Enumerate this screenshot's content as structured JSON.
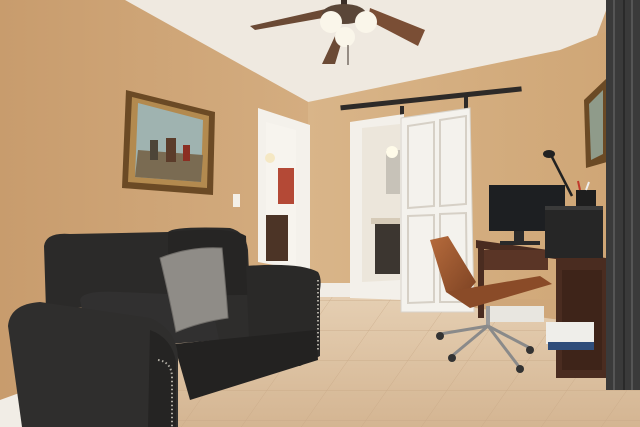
{
  "scene": {
    "description_tag": "",
    "palette": {
      "wall_left": "#caa073",
      "wall_right": "#d2ab7e",
      "ceiling": "#f1ece4",
      "floor_tile": "#dcbf9f",
      "sofa": "#2c2b2a",
      "door": "#f3f1ec",
      "desk": "#5a3526",
      "chair_wood": "#9a5630",
      "curtain": "#3a3a3a"
    }
  }
}
